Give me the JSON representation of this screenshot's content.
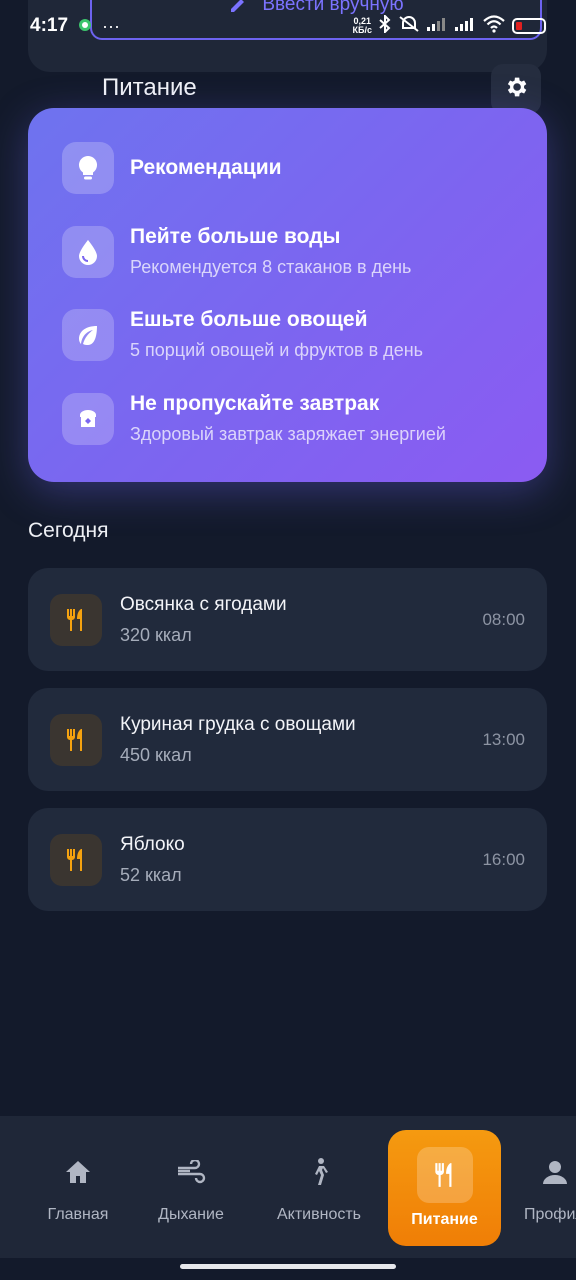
{
  "status_bar": {
    "time": "4:17",
    "dots": "···",
    "net_speed_value": "0,21",
    "net_speed_unit": "КБ/с"
  },
  "top_card": {
    "manual_entry_label": "Ввести вручную"
  },
  "header": {
    "title": "Питание"
  },
  "recommendations": {
    "title": "Рекомендации",
    "items": [
      {
        "title": "Пейте больше воды",
        "subtitle": "Рекомендуется 8 стаканов в день",
        "icon": "water-drop-icon"
      },
      {
        "title": "Ешьте больше овощей",
        "subtitle": "5 порций овощей и фруктов в день",
        "icon": "leaf-icon"
      },
      {
        "title": "Не пропускайте завтрак",
        "subtitle": "Здоровый завтрак заряжает энергией",
        "icon": "breakfast-icon"
      }
    ]
  },
  "today": {
    "title": "Сегодня",
    "meals": [
      {
        "name": "Овсянка с ягодами",
        "kcal": "320 ккал",
        "time": "08:00"
      },
      {
        "name": "Куриная грудка с овощами",
        "kcal": "450 ккал",
        "time": "13:00"
      },
      {
        "name": "Яблоко",
        "kcal": "52 ккал",
        "time": "16:00"
      }
    ]
  },
  "nav": {
    "items": [
      {
        "label": "Главная",
        "icon": "home-icon"
      },
      {
        "label": "Дыхание",
        "icon": "wind-icon"
      },
      {
        "label": "Активность",
        "icon": "walk-icon"
      },
      {
        "label": "Питание",
        "icon": "food-icon",
        "active": true
      },
      {
        "label": "Профиль",
        "icon": "profile-icon"
      }
    ]
  },
  "colors": {
    "background": "#131a2b",
    "card": "#212a3c",
    "accent_purple": "#7b66f0",
    "accent_orange": "#f59a10"
  }
}
